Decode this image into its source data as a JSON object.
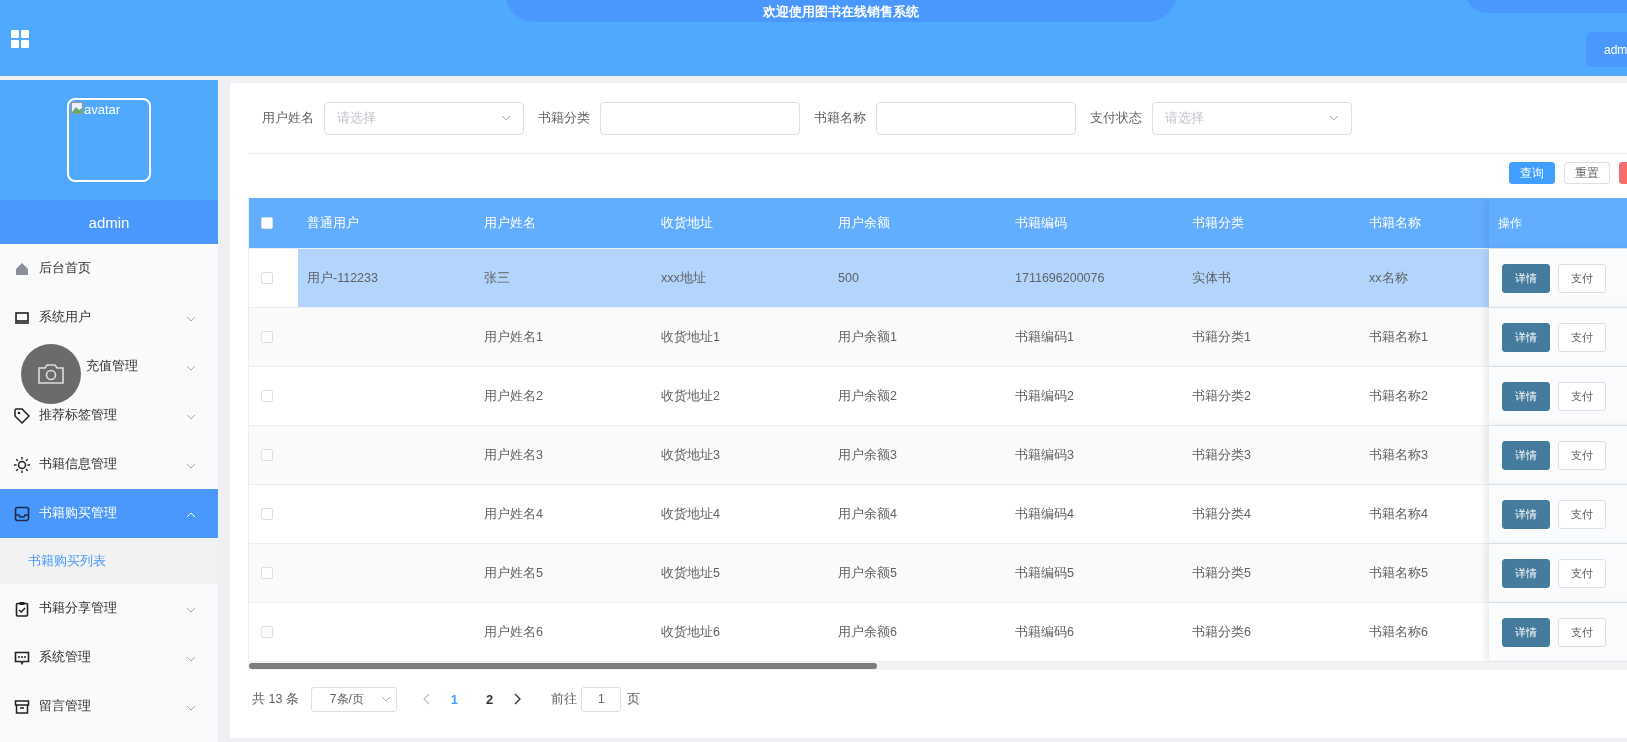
{
  "header": {
    "title": "欢迎使用图书在线销售系统",
    "user_button": "adm"
  },
  "sidebar": {
    "avatar_alt": "avatar",
    "username": "admin",
    "menu": [
      {
        "label": "后台首页",
        "selected": false
      },
      {
        "label": "系统用户",
        "selected": false,
        "expanded": false
      },
      {
        "label": "充值管理",
        "selected": false,
        "expanded": false
      },
      {
        "label": "推荐标签管理",
        "selected": false,
        "expanded": false
      },
      {
        "label": "书籍信息管理",
        "selected": false,
        "expanded": false
      },
      {
        "label": "书籍购买管理",
        "selected": true,
        "expanded": true,
        "children": [
          {
            "label": "书籍购买列表",
            "selected": true
          }
        ]
      },
      {
        "label": "书籍分享管理",
        "selected": false,
        "expanded": false
      },
      {
        "label": "系统管理",
        "selected": false,
        "expanded": false
      },
      {
        "label": "留言管理",
        "selected": false,
        "expanded": false
      }
    ]
  },
  "filters": [
    {
      "label": "用户姓名",
      "kind": "select",
      "placeholder": "请选择"
    },
    {
      "label": "书籍分类",
      "kind": "input"
    },
    {
      "label": "书籍名称",
      "kind": "input"
    },
    {
      "label": "支付状态",
      "kind": "select",
      "placeholder": "请选择"
    }
  ],
  "toolbar": [
    {
      "label": "查询",
      "kind": "primary"
    },
    {
      "label": "重置",
      "kind": "default"
    },
    {
      "kind": "danger"
    }
  ],
  "table": {
    "select_all_checked": false,
    "columns": [
      "普通用户",
      "用户姓名",
      "收货地址",
      "用户余额",
      "书籍编码",
      "书籍分类",
      "书籍名称",
      "操作"
    ],
    "rows": [
      {
        "selected": true,
        "checked": false,
        "cells": [
          "用户-112233",
          "张三",
          "xxx地址",
          "500",
          "1711696200076",
          "实体书",
          "xx名称"
        ],
        "actions": [
          "详情",
          "支付"
        ]
      },
      {
        "selected": false,
        "checked": false,
        "cells": [
          null,
          "用户姓名1",
          "收货地址1",
          "用户余额1",
          "书籍编码1",
          "书籍分类1",
          "书籍名称1"
        ],
        "actions": [
          "详情",
          "支付"
        ]
      },
      {
        "selected": false,
        "checked": false,
        "cells": [
          null,
          "用户姓名2",
          "收货地址2",
          "用户余额2",
          "书籍编码2",
          "书籍分类2",
          "书籍名称2"
        ],
        "actions": [
          "详情",
          "支付"
        ]
      },
      {
        "selected": false,
        "checked": false,
        "cells": [
          null,
          "用户姓名3",
          "收货地址3",
          "用户余额3",
          "书籍编码3",
          "书籍分类3",
          "书籍名称3"
        ],
        "actions": [
          "详情",
          "支付"
        ]
      },
      {
        "selected": false,
        "checked": false,
        "cells": [
          null,
          "用户姓名4",
          "收货地址4",
          "用户余额4",
          "书籍编码4",
          "书籍分类4",
          "书籍名称4"
        ],
        "actions": [
          "详情",
          "支付"
        ]
      },
      {
        "selected": false,
        "checked": false,
        "cells": [
          null,
          "用户姓名5",
          "收货地址5",
          "用户余额5",
          "书籍编码5",
          "书籍分类5",
          "书籍名称5"
        ],
        "actions": [
          "详情",
          "支付"
        ]
      },
      {
        "selected": false,
        "checked": false,
        "cells": [
          null,
          "用户姓名6",
          "收货地址6",
          "用户余额6",
          "书籍编码6",
          "书籍分类6",
          "书籍名称6"
        ],
        "actions": [
          "详情",
          "支付"
        ]
      }
    ]
  },
  "pagination": {
    "total": "共 13 条",
    "page_size": "7条/页",
    "pages": [
      {
        "label": "1",
        "selected": true
      },
      {
        "label": "2",
        "selected": false
      }
    ],
    "prev_disabled": true,
    "goto_label": "前往",
    "goto_value": "1",
    "page_suffix": "页"
  }
}
